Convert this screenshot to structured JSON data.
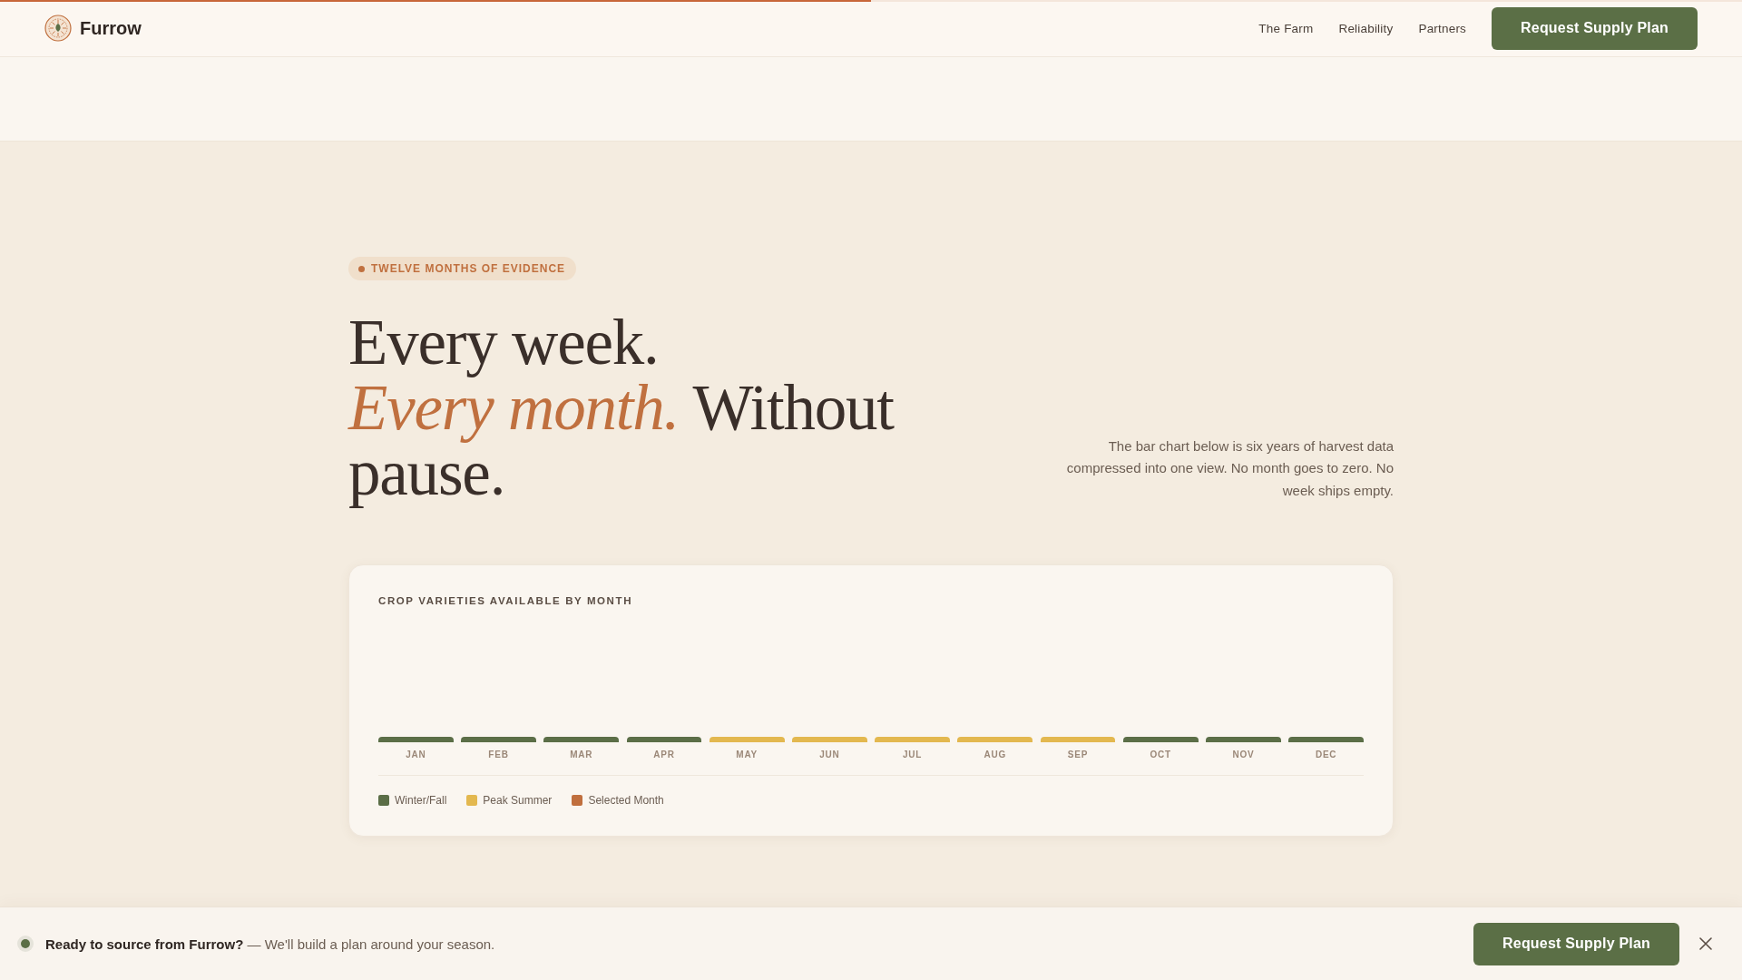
{
  "header": {
    "brand": "Furrow",
    "nav": [
      "The Farm",
      "Reliability",
      "Partners"
    ],
    "cta": "Request Supply Plan"
  },
  "scroll_progress": {
    "level": 0.5
  },
  "section": {
    "eyebrow": "TWELVE MONTHS OF EVIDENCE",
    "heading": [
      "Every week.",
      "*Every month.* Without pause."
    ],
    "description": "The bar chart below is six years of harvest data compressed into one view. No month goes to zero. No week ships empty."
  },
  "chart": {
    "title": "CROP VARIETIES AVAILABLE BY MONTH",
    "months": [
      {
        "label": "JAN",
        "color": "#5b6e47"
      },
      {
        "label": "FEB",
        "color": "#5b6e47"
      },
      {
        "label": "MAR",
        "color": "#5b6e47"
      },
      {
        "label": "APR",
        "color": "#5b6e47"
      },
      {
        "label": "MAY",
        "color": "#e3b84f"
      },
      {
        "label": "JUN",
        "color": "#e3b84f"
      },
      {
        "label": "JUL",
        "color": "#e3b84f"
      },
      {
        "label": "AUG",
        "color": "#e3b84f"
      },
      {
        "label": "SEP",
        "color": "#e3b84f"
      },
      {
        "label": "OCT",
        "color": "#5b6e47"
      },
      {
        "label": "NOV",
        "color": "#5b6e47"
      },
      {
        "label": "DEC",
        "color": "#5b6e47"
      }
    ],
    "legend": [
      {
        "label": "Winter/Fall",
        "color": "#5b6e47"
      },
      {
        "label": "Peak Summer",
        "color": "#e3b84f"
      },
      {
        "label": "Selected Month",
        "color": "#c06f3e"
      }
    ]
  },
  "banner": {
    "message": "**Ready to source from Furrow?** — We'll build a plan around your season.",
    "cta": "Request Supply Plan"
  }
}
